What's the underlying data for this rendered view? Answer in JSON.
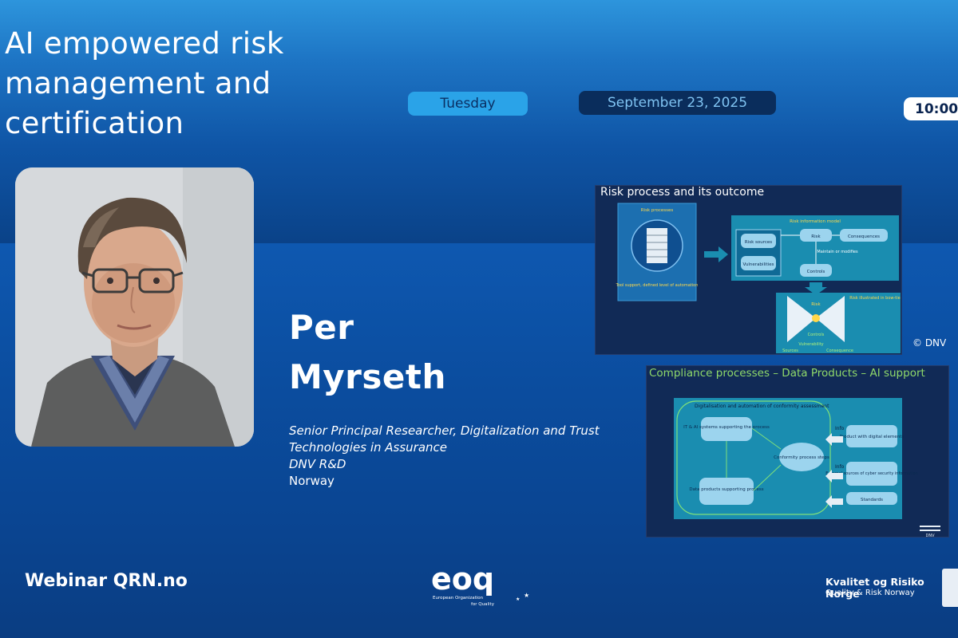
{
  "title": "AI empowered risk management and certification",
  "schedule": {
    "day": "Tuesday",
    "date": "September 23, 2025",
    "time": "10:00"
  },
  "speaker": {
    "name_first": "Per",
    "name_last": "Myrseth",
    "role_line1": "Senior Principal Researcher, Digitalization and  Trust",
    "role_line2": "Technologies in Assurance",
    "org": "DNV R&D",
    "country": "Norway"
  },
  "slide1": {
    "title": "Risk process and its outcome",
    "box_processes": "Risk processes",
    "box_tool": "Tool support, defined level of automation",
    "model_title": "Risk information model",
    "risk_sources": "Risk sources",
    "vulnerabilities": "Vulnerabilities",
    "risk": "Risk",
    "consequences": "Consequences",
    "maintain": "Maintain or modifies",
    "controls": "Controls",
    "bowtie_title": "Risk illustrated in bow-tie",
    "bowtie_risk": "Risk",
    "bowtie_controls": "Controls",
    "bowtie_vuln": "Vulnerability",
    "bowtie_sources": "Sources",
    "bowtie_conseq": "Consequence",
    "copyright": "© DNV"
  },
  "slide2": {
    "title": "Compliance processes – Data Products – AI support",
    "frame_title": "Digitalisation and automation of conformity assessment",
    "it_ai": "IT & AI systems supporting the process",
    "conformity": "Conformity process steps",
    "data_products": "Data products supporting process",
    "info1": "Info",
    "info2": "Info",
    "product": "Product with digital elements",
    "external": "External sources of cyber security information",
    "standards": "Standards",
    "footer_logo": "DNV"
  },
  "footer": {
    "webinar": "Webinar  QRN.no",
    "eoq_logo": "eoq",
    "eoq_sub1": "European Organization",
    "eoq_sub2": "for Quality",
    "krn_name": "Kvalitet og Risiko Norge",
    "krn_sub": "Quality & Risk Norway"
  },
  "colors": {
    "accent": "#2aa3e8",
    "date_pill": "#0a2d5c",
    "slide_bg": "#112a56",
    "teal": "#1a8db0",
    "green_title": "#8fd96a"
  }
}
